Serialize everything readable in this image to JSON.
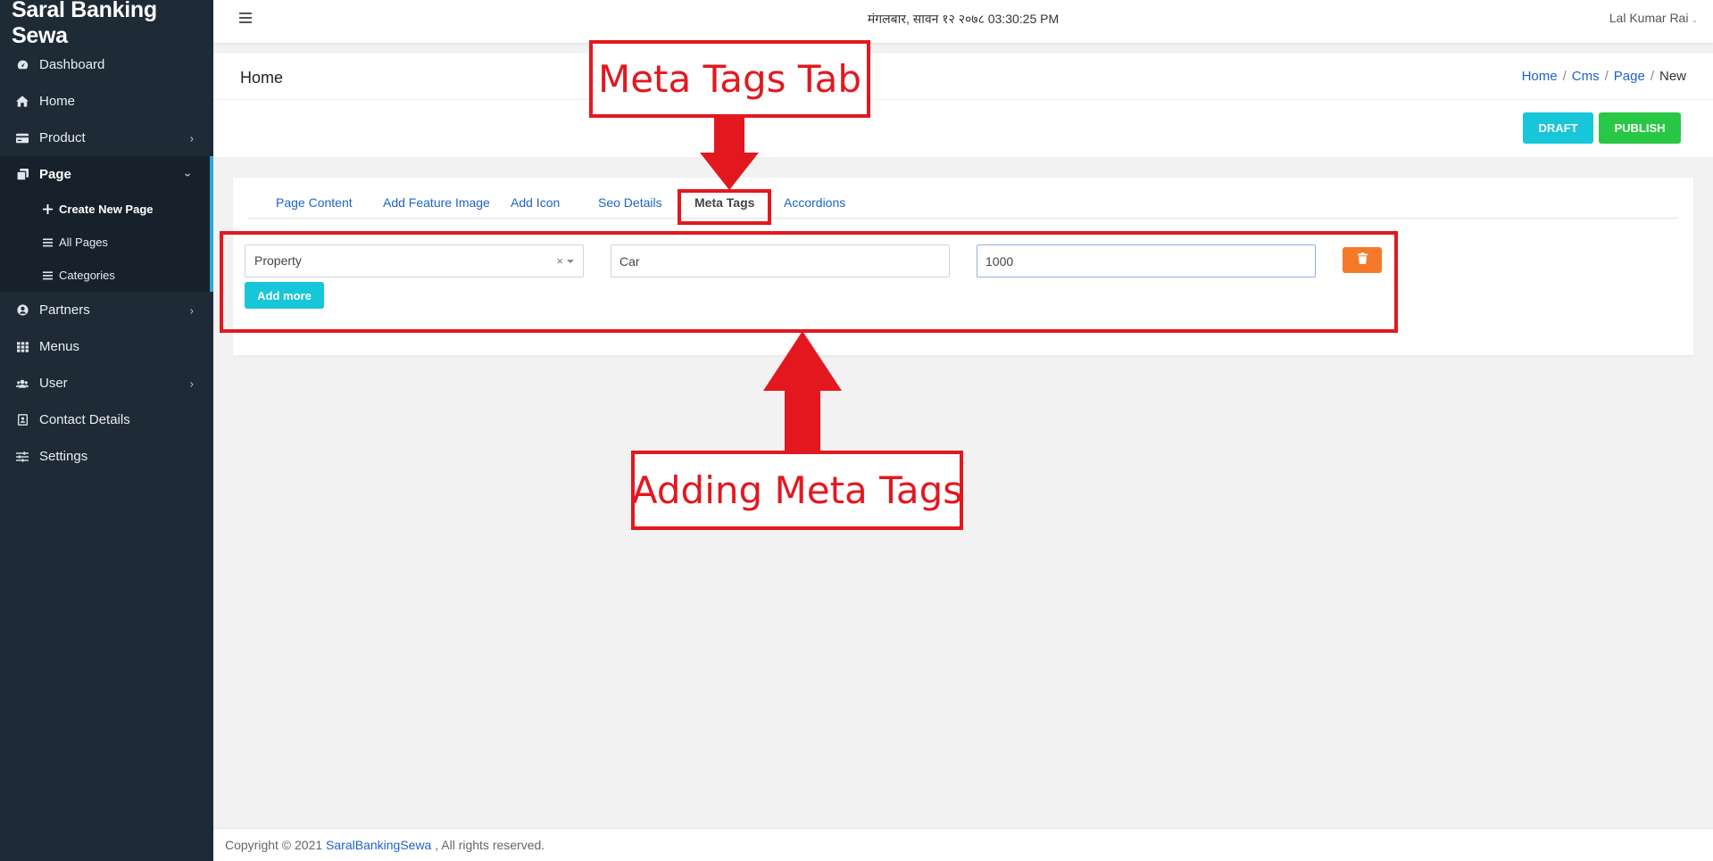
{
  "sidebar": {
    "brand": "Saral Banking Sewa",
    "items": [
      {
        "label": "Dashboard",
        "icon": "dashboard-icon"
      },
      {
        "label": "Home",
        "icon": "home-icon"
      },
      {
        "label": "Product",
        "icon": "card-icon"
      },
      {
        "label": "Page",
        "icon": "pages-icon"
      },
      {
        "label": "Partners",
        "icon": "user-circle-icon"
      },
      {
        "label": "Menus",
        "icon": "grid-icon"
      },
      {
        "label": "User",
        "icon": "users-icon"
      },
      {
        "label": "Contact Details",
        "icon": "contact-icon"
      },
      {
        "label": "Settings",
        "icon": "sliders-icon"
      }
    ],
    "page_submenu": [
      {
        "label": "Create New Page",
        "icon": "plus-icon"
      },
      {
        "label": "All Pages",
        "icon": "list-icon"
      },
      {
        "label": "Categories",
        "icon": "list-icon"
      }
    ]
  },
  "topbar": {
    "datetime": "मंगलबार, सावन १२ २०७८ 03:30:25 PM",
    "user_name": "Lal Kumar Rai"
  },
  "header": {
    "title": "Home",
    "breadcrumb": [
      "Home",
      "Cms",
      "Page",
      "New"
    ],
    "draft_label": "DRAFT",
    "publish_label": "PUBLISH"
  },
  "tabs": [
    "Page Content",
    "Add Feature Image",
    "Add Icon",
    "Seo Details",
    "Meta Tags",
    "Accordions"
  ],
  "active_tab": "Meta Tags",
  "meta_row": {
    "type_selected": "Property",
    "name_value": "Car",
    "content_value": "1000"
  },
  "add_more_label": "Add more",
  "annotations": {
    "tab_label": "Meta Tags Tab",
    "adding_label": "Adding Meta Tags"
  },
  "footer": {
    "prefix": "Copyright © 2021 ",
    "link": "SaralBankingSewa",
    "suffix": " , All rights reserved."
  },
  "colors": {
    "sidebar_bg": "#1e2a35",
    "accent_cyan": "#17c6d8",
    "publish_green": "#28c745",
    "delete_orange": "#f47a2a",
    "annotation_red": "#e3181f",
    "link_blue": "#1f63c6"
  }
}
